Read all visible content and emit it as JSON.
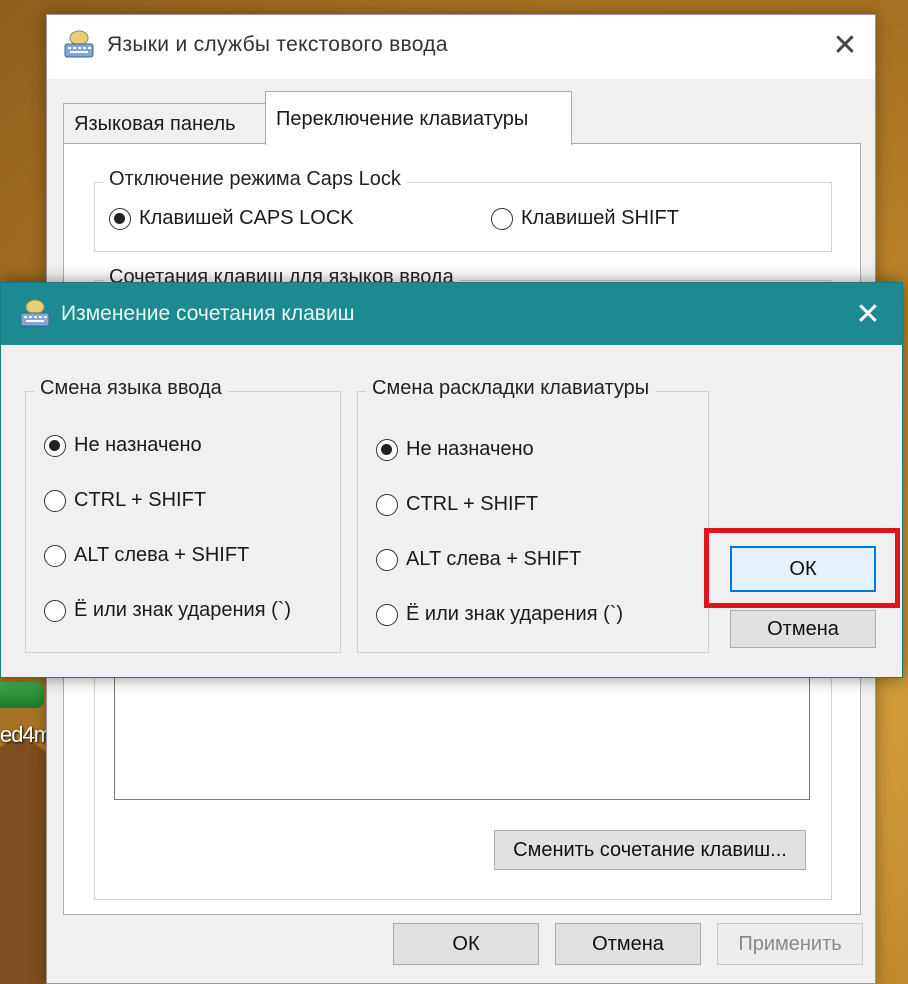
{
  "desktop": {
    "icon_label": "ed4m"
  },
  "main_window": {
    "title": "Языки и службы текстового ввода",
    "close_glyph": "✕",
    "tabs": [
      {
        "label": "Языковая панель",
        "active": false
      },
      {
        "label": "Переключение клавиатуры",
        "active": true
      }
    ],
    "caps_group": {
      "legend": "Отключение режима Caps Lock",
      "options": [
        {
          "label": "Клавишей CAPS LOCK",
          "selected": true
        },
        {
          "label": "Клавишей SHIFT",
          "selected": false
        }
      ]
    },
    "keys_group": {
      "legend": "Сочетания клавиш для языков ввода"
    },
    "change_button": "Сменить сочетание клавиш...",
    "buttons": {
      "ok": "ОК",
      "cancel": "Отмена",
      "apply": "Применить"
    }
  },
  "dialog": {
    "title": "Изменение сочетания клавиш",
    "close_glyph": "✕",
    "input_lang_group": {
      "legend": "Смена языка ввода",
      "options": [
        {
          "label": "Не назначено",
          "selected": true
        },
        {
          "label": "CTRL + SHIFT",
          "selected": false
        },
        {
          "label": "ALT слева + SHIFT",
          "selected": false
        },
        {
          "label": "Ё или знак ударения (`)",
          "selected": false
        }
      ]
    },
    "layout_group": {
      "legend": "Смена раскладки клавиатуры",
      "options": [
        {
          "label": "Не назначено",
          "selected": true
        },
        {
          "label": "CTRL + SHIFT",
          "selected": false
        },
        {
          "label": "ALT слева + SHIFT",
          "selected": false
        },
        {
          "label": "Ё или знак ударения (`)",
          "selected": false
        }
      ]
    },
    "buttons": {
      "ok": "ОК",
      "cancel": "Отмена"
    }
  },
  "colors": {
    "dialog_titlebar": "#1d8a91",
    "highlight": "#e0121a",
    "default_button_border": "#0078d7"
  }
}
